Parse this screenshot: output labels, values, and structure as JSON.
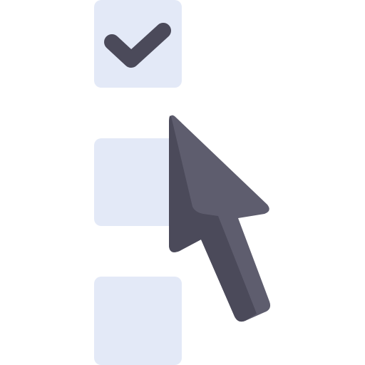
{
  "checklist": {
    "items": [
      {
        "checked": true
      },
      {
        "checked": false
      },
      {
        "checked": false
      }
    ]
  },
  "icons": {
    "check": "checkmark-icon",
    "cursor": "mouse-pointer-icon"
  },
  "colors": {
    "background": "#ffffff",
    "checkbox_fill": "#e3e9f7",
    "checkmark": "#4b4a5a",
    "cursor_light": "#5e5d6e",
    "cursor_dark": "#4b4a5a"
  }
}
